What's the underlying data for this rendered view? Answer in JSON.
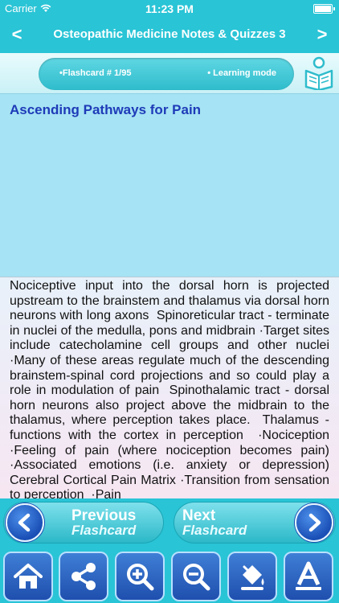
{
  "status_bar": {
    "carrier": "Carrier",
    "time": "11:23 PM"
  },
  "header": {
    "title": "Osteopathic Medicine Notes & Quizzes 3",
    "back_symbol": "<",
    "forward_symbol": ">"
  },
  "info": {
    "flashcard_label": "•Flashcard #  1/95",
    "mode_label": "• Learning mode"
  },
  "card": {
    "title": "Ascending Pathways for Pain",
    "body": "Nociceptive input into the dorsal horn is projected upstream to the brainstem and thalamus via dorsal horn neurons with long axons  Spinoreticular tract - terminate in nuclei of the medulla, pons and midbrain ·Target sites include catecholamine cell groups and other nuclei ·Many of these areas regulate much of the descending brainstem-spinal cord projections and so could play a role in modulation of pain  Spinothalamic tract - dorsal horn neurons also project above the midbrain to the thalamus, where perception takes place.  Thalamus - functions with the cortex in perception  ·Nociception  ·Feeling of pain (where nociception becomes pain) ·Associated emotions (i.e. anxiety or depression)  Cerebral Cortical Pain Matrix ·Transition from sensation to perception  ·Pain"
  },
  "buttons": {
    "previous": {
      "line1": "Previous",
      "line2": "Flashcard"
    },
    "next": {
      "line1": "Next",
      "line2": "Flashcard"
    }
  },
  "toolbar": {
    "icons": [
      "home-icon",
      "share-icon",
      "zoom-in-icon",
      "zoom-out-icon",
      "paint-bucket-icon",
      "font-icon"
    ]
  },
  "colors": {
    "accent": "#29c4d6",
    "button_blue": "#1f4fae",
    "title_blue": "#1e3bb8",
    "card_head": "#a6e3f4"
  }
}
